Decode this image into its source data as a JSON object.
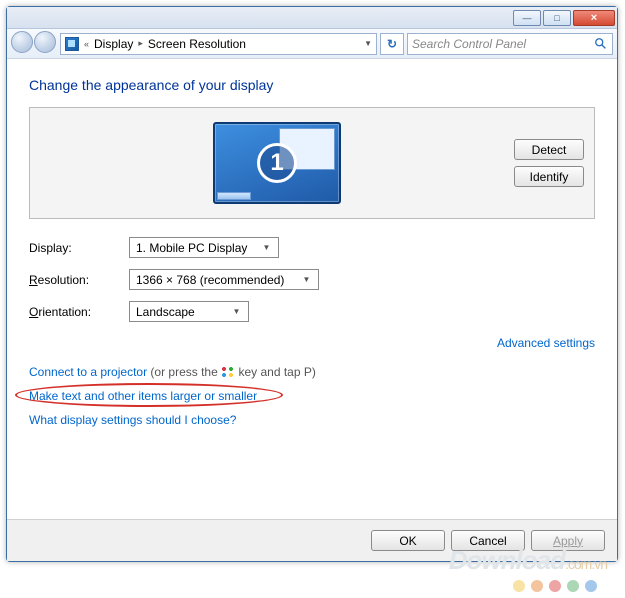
{
  "window_controls": {
    "min": "—",
    "max": "□",
    "close": "×"
  },
  "breadcrumb": {
    "back_chevron": "«",
    "item1": "Display",
    "item2": "Screen Resolution",
    "dropdown_glyph": "▼"
  },
  "refresh_glyph": "↻",
  "search": {
    "placeholder": "Search Control Panel"
  },
  "heading": "Change the appearance of your display",
  "monitor_number": "1",
  "buttons": {
    "detect": "Detect",
    "identify": "Identify",
    "ok": "OK",
    "cancel": "Cancel",
    "apply": "Apply"
  },
  "fields": {
    "display_label_pre": "D",
    "display_label_post": "isplay:",
    "display_value": "1. Mobile PC Display",
    "resolution_label_pre": "R",
    "resolution_label_post": "esolution:",
    "resolution_value": "1366 × 768 (recommended)",
    "orientation_label_pre": "O",
    "orientation_label_post": "rientation:",
    "orientation_value": "Landscape"
  },
  "links": {
    "advanced": "Advanced settings",
    "projector": "Connect to a projector",
    "projector_hint_pre": " (or press the ",
    "projector_hint_post": " key and tap P)",
    "resize_text": "Make text and other items larger or smaller",
    "which_settings": "What display settings should I choose?"
  },
  "watermark": {
    "main": "Download",
    "suffix": ".com.vn"
  },
  "dot_colors": [
    "#f2c84b",
    "#e88a3c",
    "#d94a4a",
    "#5ab06a",
    "#4a8fd9"
  ]
}
